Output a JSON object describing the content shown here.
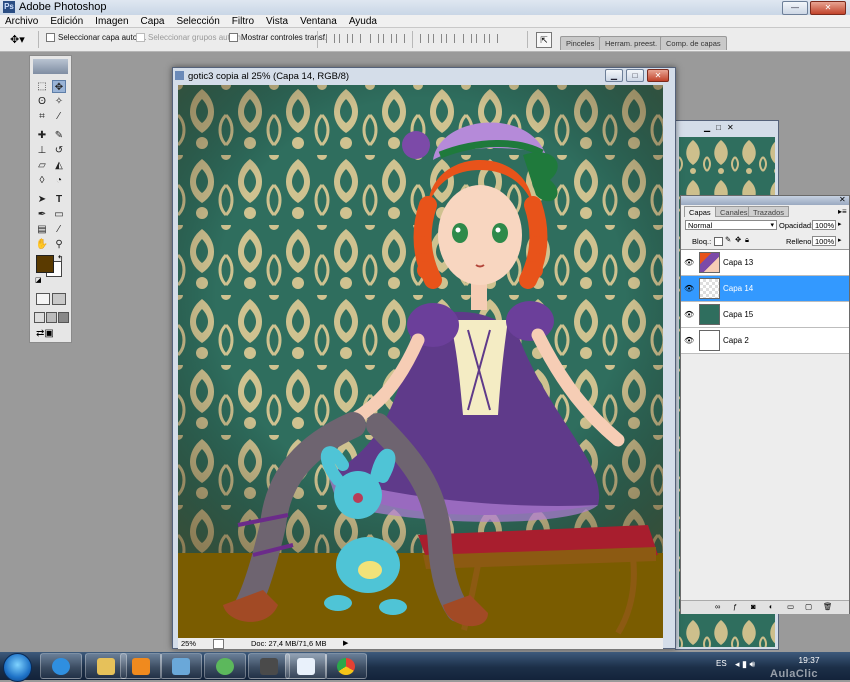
{
  "app": {
    "title": "Adobe Photoshop"
  },
  "window_controls": {
    "minimize": "—",
    "maximize": "□",
    "close": "✕"
  },
  "menu": [
    "Archivo",
    "Edición",
    "Imagen",
    "Capa",
    "Selección",
    "Filtro",
    "Vista",
    "Ventana",
    "Ayuda"
  ],
  "options_bar": {
    "auto_select_layer": "Seleccionar capa autom.",
    "auto_select_groups": "Seleccionar grupos autom.",
    "show_transform": "Mostrar controles transf."
  },
  "palette_well": {
    "tabs": [
      "Pinceles",
      "Herram. preest.",
      "Comp. de capas"
    ]
  },
  "document": {
    "title": "gotic3 copia al 25% (Capa 14, RGB/8)",
    "zoom": "25%",
    "doc_size": "Doc: 27,4 MB/71,6 MB"
  },
  "layers_panel": {
    "tabs": [
      "Capas",
      "Canales",
      "Trazados"
    ],
    "blend_mode": "Normal",
    "opacity_label": "Opacidad:",
    "opacity": "100%",
    "lock_label": "Bloq.:",
    "fill_label": "Relleno:",
    "fill": "100%",
    "layers": [
      {
        "name": "Capa 13",
        "selected": false
      },
      {
        "name": "Capa 14",
        "selected": true
      },
      {
        "name": "Capa 15",
        "selected": false
      },
      {
        "name": "Capa 2",
        "selected": false
      }
    ]
  },
  "colors": {
    "foreground": "#5a3a00",
    "background": "#ffffff",
    "selection": "#3399ff",
    "wallpaper": "#2e6b5c",
    "floor": "#7a5c00"
  },
  "taskbar": {
    "language": "ES",
    "time": "19:37",
    "watermark": "AulaClic"
  }
}
